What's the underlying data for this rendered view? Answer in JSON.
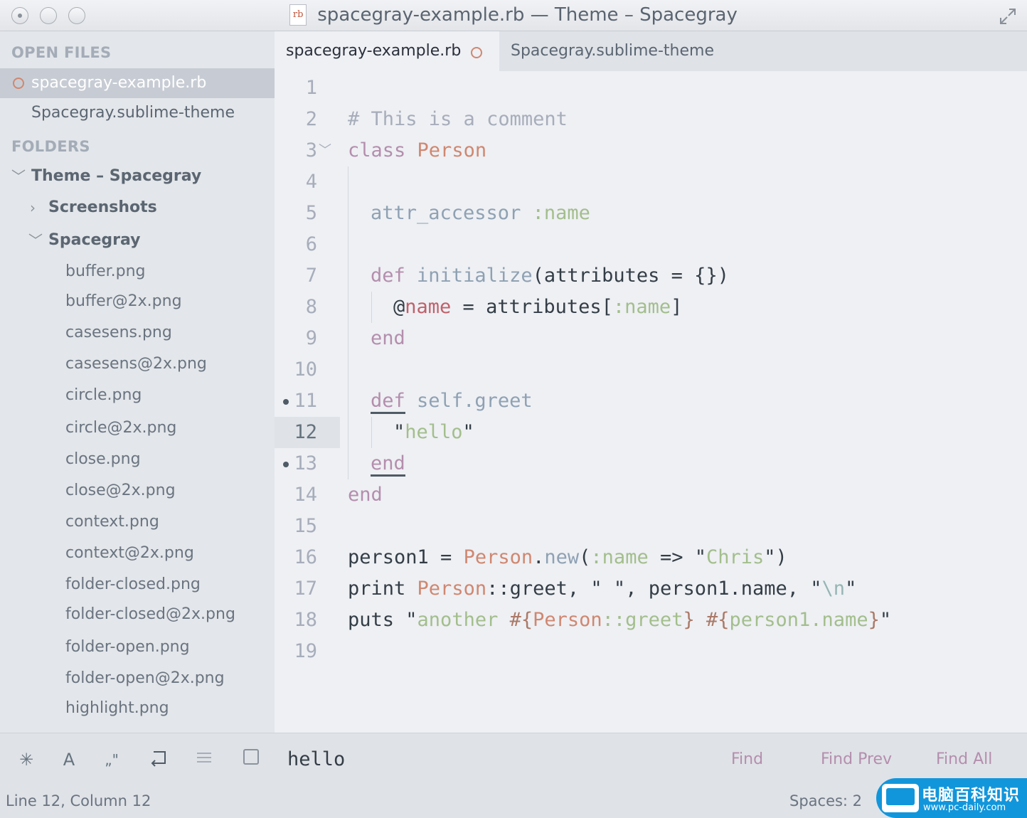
{
  "window": {
    "title": "spacegray-example.rb — Theme – Spacegray",
    "file_badge": "rb"
  },
  "sidebar": {
    "open_files_heading": "OPEN FILES",
    "open_files": [
      {
        "label": "spacegray-example.rb",
        "active": true,
        "dirty": true
      },
      {
        "label": "Spacegray.sublime-theme",
        "active": false,
        "dirty": false
      }
    ],
    "folders_heading": "FOLDERS",
    "root_folder": "Theme – Spacegray",
    "subfolders": [
      "Screenshots",
      "Spacegray"
    ],
    "files": [
      "buffer.png",
      "buffer@2x.png",
      "casesens.png",
      "casesens@2x.png",
      "circle.png",
      "circle@2x.png",
      "close.png",
      "close@2x.png",
      "context.png",
      "context@2x.png",
      "folder-closed.png",
      "folder-closed@2x.png",
      "folder-open.png",
      "folder-open@2x.png",
      "highlight.png"
    ]
  },
  "tabs": [
    {
      "label": "spacegray-example.rb",
      "active": true,
      "dirty": true
    },
    {
      "label": "Spacegray.sublime-theme",
      "active": false,
      "dirty": false
    }
  ],
  "editor": {
    "line_numbers": [
      "1",
      "2",
      "3",
      "4",
      "5",
      "6",
      "7",
      "8",
      "9",
      "10",
      "11",
      "12",
      "13",
      "14",
      "15",
      "16",
      "17",
      "18",
      "19"
    ],
    "current_line": 12,
    "bookmarked_lines": [
      11,
      13
    ],
    "tokens": {
      "l2": [
        "# This is a comment"
      ],
      "l3": [
        "class",
        " ",
        "Person"
      ],
      "l5": [
        "attr_accessor",
        " ",
        ":name"
      ],
      "l7": [
        "def",
        " ",
        "initialize",
        "(attributes = {})"
      ],
      "l8": [
        "@",
        "name",
        " = attributes[",
        ":name",
        "]"
      ],
      "l9": [
        "end"
      ],
      "l11": [
        "def",
        " ",
        "self",
        ".",
        "greet"
      ],
      "l12": [
        "\"",
        "hello",
        "\""
      ],
      "l13": [
        "end"
      ],
      "l14": [
        "end"
      ],
      "l16": [
        "person1 = ",
        "Person",
        ".",
        "new",
        "(",
        ":name",
        " => ",
        "\"",
        "Chris",
        "\"",
        ")"
      ],
      "l17": [
        "print ",
        "Person",
        "::greet, ",
        "\" \"",
        ", person1.name, ",
        "\"",
        "\\n",
        "\""
      ],
      "l18": [
        "puts ",
        "\"",
        "another ",
        "#{",
        "Person",
        "::greet",
        "}",
        " ",
        "#{",
        "person1",
        ".name",
        "}",
        "\""
      ]
    }
  },
  "find_panel": {
    "query": "hello",
    "buttons": {
      "find": "Find",
      "find_prev": "Find Prev",
      "find_all": "Find All"
    },
    "option_icons": [
      "regex-icon",
      "case-sensitive-icon",
      "whole-word-icon",
      "wrap-icon",
      "in-selection-icon",
      "highlight-matches-icon"
    ]
  },
  "status": {
    "position": "Line 12, Column 12",
    "indentation": "Spaces: 2"
  },
  "watermark": {
    "main": "电脑百科知识",
    "sub": "www.pc-daily.com"
  },
  "colors": {
    "accent_dirty": "#d08770",
    "keyword": "#b48ead",
    "string": "#a3be8c",
    "class": "#d08770",
    "function": "#8fa1b3"
  }
}
